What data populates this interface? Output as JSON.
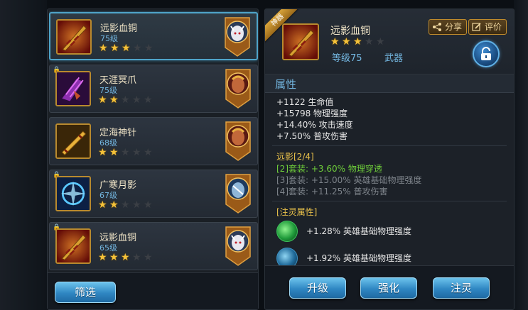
{
  "inventory": {
    "items": [
      {
        "name": "远影血铜",
        "level": "75级",
        "stars": 3,
        "max_stars": 5,
        "locked": false,
        "selected": true,
        "icon": "flaming-sword-icon",
        "hero": "white-horned-hero-portrait"
      },
      {
        "name": "天涯冥爪",
        "level": "75级",
        "stars": 2,
        "max_stars": 5,
        "locked": true,
        "selected": false,
        "icon": "purple-claw-icon",
        "hero": "red-warrior-hero-portrait"
      },
      {
        "name": "定海神针",
        "level": "68级",
        "stars": 2,
        "max_stars": 5,
        "locked": false,
        "selected": false,
        "icon": "golden-staff-icon",
        "hero": "red-warrior-hero-portrait"
      },
      {
        "name": "广寒月影",
        "level": "67级",
        "stars": 2,
        "max_stars": 5,
        "locked": true,
        "selected": false,
        "icon": "moon-ice-icon",
        "hero": "blue-armored-hero-portrait"
      },
      {
        "name": "远影血铜",
        "level": "65级",
        "stars": 3,
        "max_stars": 5,
        "locked": true,
        "selected": false,
        "icon": "flaming-sword-icon",
        "hero": "white-horned-hero-portrait"
      }
    ],
    "filter_label": "筛选"
  },
  "detail": {
    "ribbon": "神器",
    "name": "远影血铜",
    "stars": 3,
    "max_stars": 5,
    "level": "等级75",
    "type": "武器",
    "share_label": "分享",
    "review_label": "评价",
    "attributes_title": "属性",
    "attributes": [
      "+1122 生命值",
      "+15798 物理强度",
      "+14.40% 攻击速度",
      "+7.50% 普攻伤害"
    ],
    "set_title": "远影[2/4]",
    "set_bonuses": [
      {
        "text": "[2]套装: +3.60% 物理穿透",
        "active": true
      },
      {
        "text": "[3]套装: +15.00% 英雄基础物理强度",
        "active": false
      },
      {
        "text": "[4]套装: +11.25% 普攻伤害",
        "active": false
      }
    ],
    "spirit_title": "[注灵属性]",
    "spirit_lines": [
      "+1.28% 英雄基础物理强度",
      "+1.92% 英雄基础物理强度"
    ],
    "actions": {
      "upgrade": "升级",
      "enhance": "强化",
      "infuse": "注灵"
    }
  },
  "colors": {
    "accent_blue": "#73b6e0",
    "gold": "#f5c23a",
    "set_active": "#6fcf3a",
    "set_inactive": "#7d838a",
    "section_yellow": "#e8c04a"
  }
}
